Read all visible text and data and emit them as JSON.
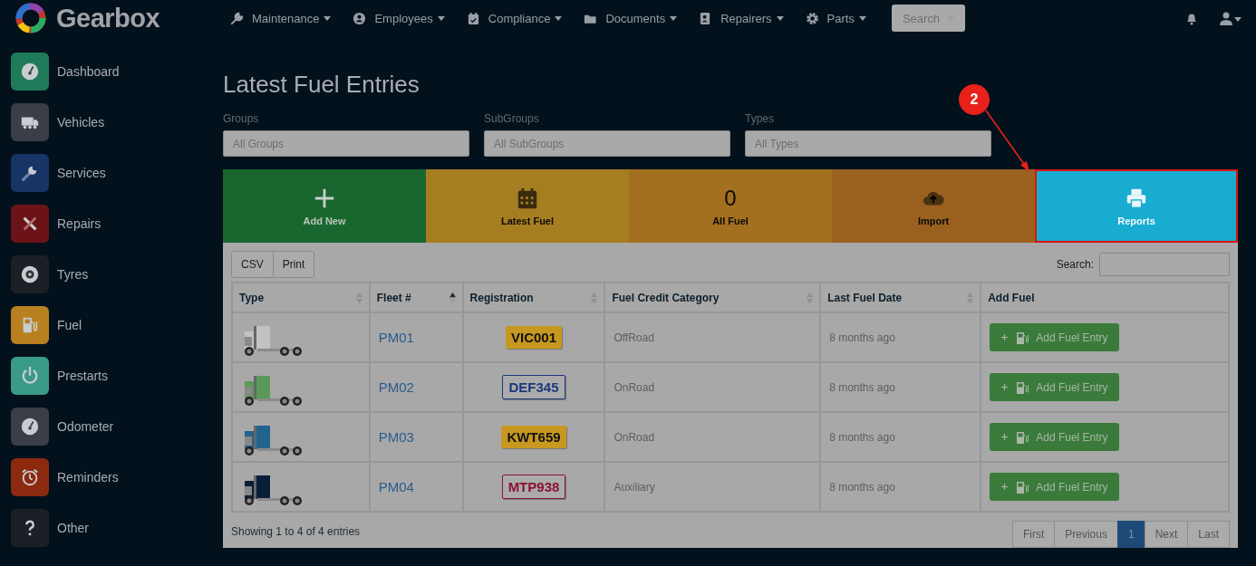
{
  "brand": {
    "name": "Gearbox"
  },
  "nav": [
    {
      "label": "Maintenance",
      "kind": "wrench"
    },
    {
      "label": "Employees",
      "kind": "person"
    },
    {
      "label": "Compliance",
      "kind": "calendar"
    },
    {
      "label": "Documents",
      "kind": "folder"
    },
    {
      "label": "Repairers",
      "kind": "contact"
    },
    {
      "label": "Parts",
      "kind": "gear"
    }
  ],
  "search_button": {
    "label": "Search"
  },
  "sidebar": {
    "items": [
      {
        "label": "Dashboard",
        "kind": "gauge",
        "color": "#1f7a5a"
      },
      {
        "label": "Vehicles",
        "kind": "truck",
        "color": "#3b3e46"
      },
      {
        "label": "Services",
        "kind": "wrench",
        "color": "#173466"
      },
      {
        "label": "Repairs",
        "kind": "tools",
        "color": "#6b1317"
      },
      {
        "label": "Tyres",
        "kind": "tyre",
        "color": "#1d1f26"
      },
      {
        "label": "Fuel",
        "kind": "fuel",
        "color": "#b8801f"
      },
      {
        "label": "Prestarts",
        "kind": "power",
        "color": "#3a9a88"
      },
      {
        "label": "Odometer",
        "kind": "gauge",
        "color": "#3b3e46"
      },
      {
        "label": "Reminders",
        "kind": "alarm",
        "color": "#8c2a10"
      },
      {
        "label": "Other",
        "kind": "question",
        "color": "#1d1f26"
      }
    ]
  },
  "page_title": "Latest Fuel Entries",
  "filters": [
    {
      "label": "Groups",
      "placeholder": "All Groups"
    },
    {
      "label": "SubGroups",
      "placeholder": "All SubGroups"
    },
    {
      "label": "Types",
      "placeholder": "All Types"
    }
  ],
  "tiles": [
    {
      "label": "Add New",
      "kind": "plus",
      "color": "#19672f",
      "selected": false
    },
    {
      "label": "Latest Fuel",
      "kind": "calendar",
      "color": "#a67e22",
      "selected": false
    },
    {
      "label": "All Fuel",
      "kind": "count",
      "value": "0",
      "color": "#a2701f",
      "selected": false
    },
    {
      "label": "Import",
      "kind": "cloud",
      "color": "#9a6020",
      "selected": false
    },
    {
      "label": "Reports",
      "kind": "printer",
      "color": "#17acd0",
      "selected": true
    }
  ],
  "annotation": {
    "number": "2"
  },
  "table": {
    "export_buttons": [
      "CSV",
      "Print"
    ],
    "search_label": "Search:",
    "columns": [
      {
        "label": "Type",
        "sorted": false
      },
      {
        "label": "Fleet #",
        "sorted": true
      },
      {
        "label": "Registration",
        "sorted": false
      },
      {
        "label": "Fuel Credit Category",
        "sorted": false
      },
      {
        "label": "Last Fuel Date",
        "sorted": false
      },
      {
        "label": "Add Fuel"
      }
    ],
    "rows": [
      {
        "color": "#c2c2c2",
        "fleet": "PM01",
        "registration": "VIC001",
        "kind": "gold",
        "category": "OffRoad",
        "last_fuel": "8 months ago",
        "action": "Add Fuel Entry"
      },
      {
        "color": "#5a9a58",
        "fleet": "PM02",
        "registration": "DEF345",
        "kind": "blue",
        "category": "OnRoad",
        "last_fuel": "8 months ago",
        "action": "Add Fuel Entry"
      },
      {
        "color": "#23648e",
        "fleet": "PM03",
        "registration": "KWT659",
        "kind": "gold",
        "category": "OnRoad",
        "last_fuel": "8 months ago",
        "action": "Add Fuel Entry"
      },
      {
        "color": "#0a1e38",
        "fleet": "PM04",
        "registration": "MTP938",
        "kind": "red",
        "category": "Auxiliary",
        "last_fuel": "8 months ago",
        "action": "Add Fuel Entry"
      }
    ],
    "info": "Showing 1 to 4 of 4 entries",
    "pages": [
      {
        "label": "First",
        "selected": false
      },
      {
        "label": "Previous",
        "selected": false
      },
      {
        "label": "1",
        "selected": true
      },
      {
        "label": "Next",
        "selected": false
      },
      {
        "label": "Last",
        "selected": false
      }
    ]
  }
}
